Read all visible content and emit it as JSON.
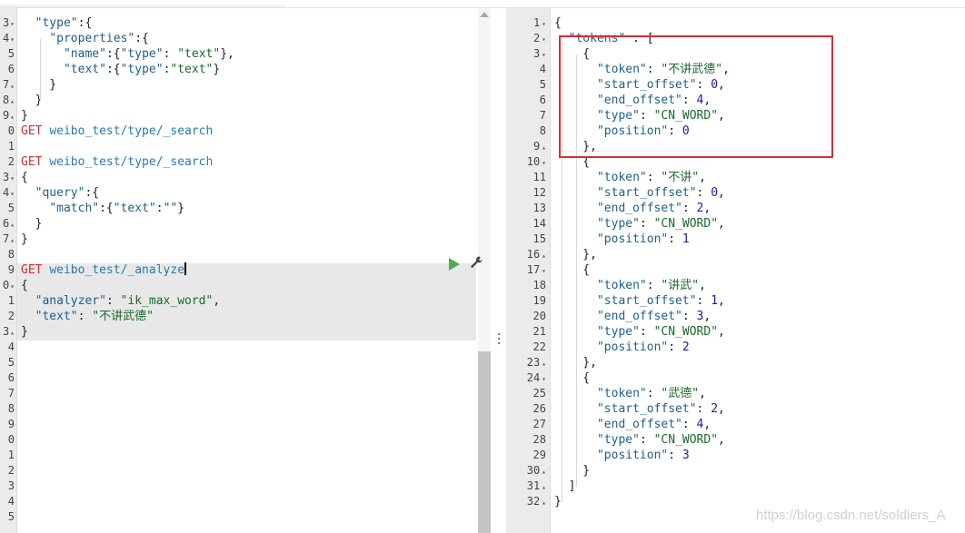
{
  "request_editor": {
    "lines": [
      {
        "no": "3",
        "fold": "▾",
        "html_parts": [
          [
            "  ",
            "p"
          ],
          [
            "\"type\"",
            "k"
          ],
          [
            ":{",
            "p"
          ]
        ]
      },
      {
        "no": "4",
        "fold": "▾",
        "html_parts": [
          [
            "    ",
            "p"
          ],
          [
            "\"properties\"",
            "k"
          ],
          [
            ":{",
            "p"
          ]
        ]
      },
      {
        "no": "5",
        "fold": "",
        "html_parts": [
          [
            "      ",
            "p"
          ],
          [
            "\"name\"",
            "k"
          ],
          [
            ":{",
            "p"
          ],
          [
            "\"type\"",
            "k"
          ],
          [
            ": ",
            "p"
          ],
          [
            "\"text\"",
            "s"
          ],
          [
            "},",
            "p"
          ]
        ]
      },
      {
        "no": "6",
        "fold": "",
        "html_parts": [
          [
            "      ",
            "p"
          ],
          [
            "\"text\"",
            "k"
          ],
          [
            ":{",
            "p"
          ],
          [
            "\"type\"",
            "k"
          ],
          [
            ":",
            "p"
          ],
          [
            "\"text\"",
            "s"
          ],
          [
            "}",
            "p"
          ]
        ]
      },
      {
        "no": "7",
        "fold": "▴",
        "html_parts": [
          [
            "    }",
            "p"
          ]
        ]
      },
      {
        "no": "8",
        "fold": "▴",
        "html_parts": [
          [
            "  }",
            "p"
          ]
        ]
      },
      {
        "no": "9",
        "fold": "▴",
        "html_parts": [
          [
            "}",
            "p"
          ]
        ]
      },
      {
        "no": "0",
        "fold": "",
        "html_parts": [
          [
            "GET",
            "m"
          ],
          [
            " ",
            "p"
          ],
          [
            "weibo_test/type/_search",
            "u"
          ]
        ]
      },
      {
        "no": "1",
        "fold": "",
        "html_parts": []
      },
      {
        "no": "2",
        "fold": "",
        "html_parts": [
          [
            "GET",
            "m"
          ],
          [
            " ",
            "p"
          ],
          [
            "weibo_test/type/_search",
            "u"
          ]
        ]
      },
      {
        "no": "3",
        "fold": "▾",
        "html_parts": [
          [
            "{",
            "p"
          ]
        ]
      },
      {
        "no": "4",
        "fold": "▾",
        "html_parts": [
          [
            "  ",
            "p"
          ],
          [
            "\"query\"",
            "k"
          ],
          [
            ":{",
            "p"
          ]
        ]
      },
      {
        "no": "5",
        "fold": "",
        "html_parts": [
          [
            "    ",
            "p"
          ],
          [
            "\"match\"",
            "k"
          ],
          [
            ":{",
            "p"
          ],
          [
            "\"text\"",
            "k"
          ],
          [
            ":",
            "p"
          ],
          [
            "\"\"",
            "s"
          ],
          [
            "}",
            "p"
          ]
        ]
      },
      {
        "no": "6",
        "fold": "▴",
        "html_parts": [
          [
            "  }",
            "p"
          ]
        ]
      },
      {
        "no": "7",
        "fold": "▴",
        "html_parts": [
          [
            "}",
            "p"
          ]
        ]
      },
      {
        "no": "8",
        "fold": "",
        "html_parts": []
      },
      {
        "no": "9",
        "fold": "",
        "html_parts": [
          [
            "GET",
            "m"
          ],
          [
            " ",
            "p"
          ],
          [
            "weibo_test/_analyze",
            "u"
          ]
        ]
      },
      {
        "no": "0",
        "fold": "▾",
        "html_parts": [
          [
            "{",
            "p"
          ]
        ]
      },
      {
        "no": "1",
        "fold": "",
        "html_parts": [
          [
            "  ",
            "p"
          ],
          [
            "\"analyzer\"",
            "k"
          ],
          [
            ": ",
            "p"
          ],
          [
            "\"ik_max_word\"",
            "s"
          ],
          [
            ",",
            "p"
          ]
        ]
      },
      {
        "no": "2",
        "fold": "",
        "html_parts": [
          [
            "  ",
            "p"
          ],
          [
            "\"text\"",
            "k"
          ],
          [
            ": ",
            "p"
          ],
          [
            "\"不讲武德\"",
            "s"
          ]
        ]
      },
      {
        "no": "3",
        "fold": "▴",
        "html_parts": [
          [
            "}",
            "p"
          ]
        ]
      },
      {
        "no": "4",
        "fold": "",
        "html_parts": []
      },
      {
        "no": "5",
        "fold": "",
        "html_parts": []
      },
      {
        "no": "6",
        "fold": "",
        "html_parts": []
      },
      {
        "no": "7",
        "fold": "",
        "html_parts": []
      },
      {
        "no": "8",
        "fold": "",
        "html_parts": []
      },
      {
        "no": "9",
        "fold": "",
        "html_parts": []
      },
      {
        "no": "0",
        "fold": "",
        "html_parts": []
      },
      {
        "no": "1",
        "fold": "",
        "html_parts": []
      },
      {
        "no": "2",
        "fold": "",
        "html_parts": []
      },
      {
        "no": "3",
        "fold": "",
        "html_parts": []
      },
      {
        "no": "4",
        "fold": "",
        "html_parts": []
      },
      {
        "no": "5",
        "fold": "",
        "html_parts": []
      }
    ]
  },
  "response_editor": {
    "lines": [
      {
        "no": "1",
        "fold": "▾",
        "html_parts": [
          [
            "{",
            "p"
          ]
        ]
      },
      {
        "no": "2",
        "fold": "▾",
        "html_parts": [
          [
            "  ",
            "p"
          ],
          [
            "\"tokens\"",
            "k"
          ],
          [
            " : [",
            "p"
          ]
        ]
      },
      {
        "no": "3",
        "fold": "▾",
        "html_parts": [
          [
            "    {",
            "p"
          ]
        ]
      },
      {
        "no": "4",
        "fold": "",
        "html_parts": [
          [
            "      ",
            "p"
          ],
          [
            "\"token\"",
            "k"
          ],
          [
            ": ",
            "p"
          ],
          [
            "\"不讲武德\"",
            "s"
          ],
          [
            ",",
            "p"
          ]
        ]
      },
      {
        "no": "5",
        "fold": "",
        "html_parts": [
          [
            "      ",
            "p"
          ],
          [
            "\"start_offset\"",
            "k"
          ],
          [
            ": ",
            "p"
          ],
          [
            "0",
            "n"
          ],
          [
            ",",
            "p"
          ]
        ]
      },
      {
        "no": "6",
        "fold": "",
        "html_parts": [
          [
            "      ",
            "p"
          ],
          [
            "\"end_offset\"",
            "k"
          ],
          [
            ": ",
            "p"
          ],
          [
            "4",
            "n"
          ],
          [
            ",",
            "p"
          ]
        ]
      },
      {
        "no": "7",
        "fold": "",
        "html_parts": [
          [
            "      ",
            "p"
          ],
          [
            "\"type\"",
            "k"
          ],
          [
            ": ",
            "p"
          ],
          [
            "\"CN_WORD\"",
            "s"
          ],
          [
            ",",
            "p"
          ]
        ]
      },
      {
        "no": "8",
        "fold": "",
        "html_parts": [
          [
            "      ",
            "p"
          ],
          [
            "\"position\"",
            "k"
          ],
          [
            ": ",
            "p"
          ],
          [
            "0",
            "n"
          ]
        ]
      },
      {
        "no": "9",
        "fold": "▴",
        "html_parts": [
          [
            "    },",
            "p"
          ]
        ]
      },
      {
        "no": "10",
        "fold": "▾",
        "html_parts": [
          [
            "    {",
            "p"
          ]
        ]
      },
      {
        "no": "11",
        "fold": "",
        "html_parts": [
          [
            "      ",
            "p"
          ],
          [
            "\"token\"",
            "k"
          ],
          [
            ": ",
            "p"
          ],
          [
            "\"不讲\"",
            "s"
          ],
          [
            ",",
            "p"
          ]
        ]
      },
      {
        "no": "12",
        "fold": "",
        "html_parts": [
          [
            "      ",
            "p"
          ],
          [
            "\"start_offset\"",
            "k"
          ],
          [
            ": ",
            "p"
          ],
          [
            "0",
            "n"
          ],
          [
            ",",
            "p"
          ]
        ]
      },
      {
        "no": "13",
        "fold": "",
        "html_parts": [
          [
            "      ",
            "p"
          ],
          [
            "\"end_offset\"",
            "k"
          ],
          [
            ": ",
            "p"
          ],
          [
            "2",
            "n"
          ],
          [
            ",",
            "p"
          ]
        ]
      },
      {
        "no": "14",
        "fold": "",
        "html_parts": [
          [
            "      ",
            "p"
          ],
          [
            "\"type\"",
            "k"
          ],
          [
            ": ",
            "p"
          ],
          [
            "\"CN_WORD\"",
            "s"
          ],
          [
            ",",
            "p"
          ]
        ]
      },
      {
        "no": "15",
        "fold": "",
        "html_parts": [
          [
            "      ",
            "p"
          ],
          [
            "\"position\"",
            "k"
          ],
          [
            ": ",
            "p"
          ],
          [
            "1",
            "n"
          ]
        ]
      },
      {
        "no": "16",
        "fold": "▴",
        "html_parts": [
          [
            "    },",
            "p"
          ]
        ]
      },
      {
        "no": "17",
        "fold": "▾",
        "html_parts": [
          [
            "    {",
            "p"
          ]
        ]
      },
      {
        "no": "18",
        "fold": "",
        "html_parts": [
          [
            "      ",
            "p"
          ],
          [
            "\"token\"",
            "k"
          ],
          [
            ": ",
            "p"
          ],
          [
            "\"讲武\"",
            "s"
          ],
          [
            ",",
            "p"
          ]
        ]
      },
      {
        "no": "19",
        "fold": "",
        "html_parts": [
          [
            "      ",
            "p"
          ],
          [
            "\"start_offset\"",
            "k"
          ],
          [
            ": ",
            "p"
          ],
          [
            "1",
            "n"
          ],
          [
            ",",
            "p"
          ]
        ]
      },
      {
        "no": "20",
        "fold": "",
        "html_parts": [
          [
            "      ",
            "p"
          ],
          [
            "\"end_offset\"",
            "k"
          ],
          [
            ": ",
            "p"
          ],
          [
            "3",
            "n"
          ],
          [
            ",",
            "p"
          ]
        ]
      },
      {
        "no": "21",
        "fold": "",
        "html_parts": [
          [
            "      ",
            "p"
          ],
          [
            "\"type\"",
            "k"
          ],
          [
            ": ",
            "p"
          ],
          [
            "\"CN_WORD\"",
            "s"
          ],
          [
            ",",
            "p"
          ]
        ]
      },
      {
        "no": "22",
        "fold": "",
        "html_parts": [
          [
            "      ",
            "p"
          ],
          [
            "\"position\"",
            "k"
          ],
          [
            ": ",
            "p"
          ],
          [
            "2",
            "n"
          ]
        ]
      },
      {
        "no": "23",
        "fold": "▴",
        "html_parts": [
          [
            "    },",
            "p"
          ]
        ]
      },
      {
        "no": "24",
        "fold": "▾",
        "html_parts": [
          [
            "    {",
            "p"
          ]
        ]
      },
      {
        "no": "25",
        "fold": "",
        "html_parts": [
          [
            "      ",
            "p"
          ],
          [
            "\"token\"",
            "k"
          ],
          [
            ": ",
            "p"
          ],
          [
            "\"武德\"",
            "s"
          ],
          [
            ",",
            "p"
          ]
        ]
      },
      {
        "no": "26",
        "fold": "",
        "html_parts": [
          [
            "      ",
            "p"
          ],
          [
            "\"start_offset\"",
            "k"
          ],
          [
            ": ",
            "p"
          ],
          [
            "2",
            "n"
          ],
          [
            ",",
            "p"
          ]
        ]
      },
      {
        "no": "27",
        "fold": "",
        "html_parts": [
          [
            "      ",
            "p"
          ],
          [
            "\"end_offset\"",
            "k"
          ],
          [
            ": ",
            "p"
          ],
          [
            "4",
            "n"
          ],
          [
            ",",
            "p"
          ]
        ]
      },
      {
        "no": "28",
        "fold": "",
        "html_parts": [
          [
            "      ",
            "p"
          ],
          [
            "\"type\"",
            "k"
          ],
          [
            ": ",
            "p"
          ],
          [
            "\"CN_WORD\"",
            "s"
          ],
          [
            ",",
            "p"
          ]
        ]
      },
      {
        "no": "29",
        "fold": "",
        "html_parts": [
          [
            "      ",
            "p"
          ],
          [
            "\"position\"",
            "k"
          ],
          [
            ": ",
            "p"
          ],
          [
            "3",
            "n"
          ]
        ]
      },
      {
        "no": "30",
        "fold": "▴",
        "html_parts": [
          [
            "    }",
            "p"
          ]
        ]
      },
      {
        "no": "31",
        "fold": "▴",
        "html_parts": [
          [
            "  ]",
            "p"
          ]
        ]
      },
      {
        "no": "32",
        "fold": "▴",
        "html_parts": [
          [
            "}",
            "p"
          ]
        ]
      }
    ]
  },
  "toolbar": {
    "run_icon": "play-icon",
    "settings_icon": "wrench-icon"
  },
  "colors": {
    "method": "#d03030",
    "url": "#2a7ab0",
    "key": "#1f5f8b",
    "string": "#1a6a2a",
    "number": "#1a1aa6",
    "highlight_border": "#d32f2f"
  },
  "watermark": "https://blog.csdn.net/soldiers_A"
}
